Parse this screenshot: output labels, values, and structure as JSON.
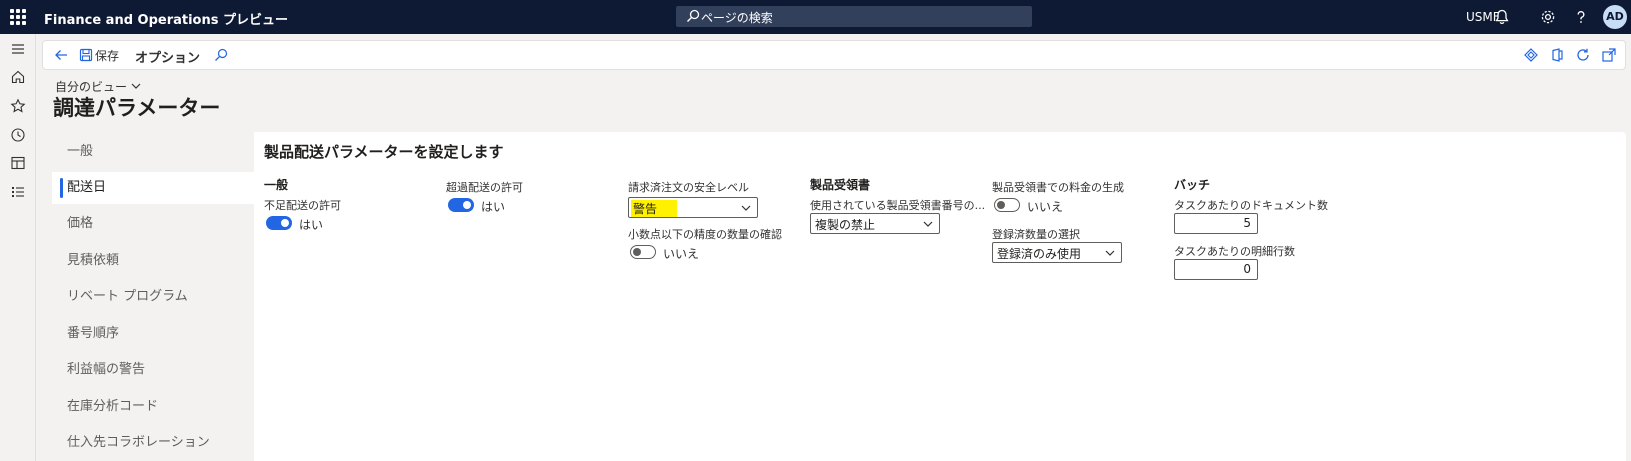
{
  "topbar": {
    "app_title": "Finance and Operations プレビュー",
    "search_placeholder": "ページの検索",
    "company": "USMF",
    "avatar_initials": "AD"
  },
  "action_pane": {
    "save_label": "保存",
    "options_label": "オプション"
  },
  "header": {
    "my_view": "自分のビュー",
    "page_title": "調達パラメーター"
  },
  "tabs": [
    {
      "label": "一般",
      "active": false
    },
    {
      "label": "配送日",
      "active": true
    },
    {
      "label": "価格",
      "active": false
    },
    {
      "label": "見積依頼",
      "active": false
    },
    {
      "label": "リベート プログラム",
      "active": false
    },
    {
      "label": "番号順序",
      "active": false
    },
    {
      "label": "利益幅の警告",
      "active": false
    },
    {
      "label": "在庫分析コード",
      "active": false
    },
    {
      "label": "仕入先コラボレーション",
      "active": false
    }
  ],
  "section": {
    "title": "製品配送パラメーターを設定します",
    "general": {
      "group_label": "一般",
      "underdelivery_label": "不足配送の許可",
      "underdelivery_value": "はい",
      "overdelivery_label": "超過配送の許可",
      "overdelivery_value": "はい",
      "invoice_security_label": "請求済注文の安全レベル",
      "invoice_security_value": "警告",
      "decimal_check_label": "小数点以下の精度の数量の確認",
      "decimal_check_value": "いいえ"
    },
    "receipt": {
      "group_label": "製品受領書",
      "number_used_label": "使用されている製品受領書番号の...",
      "number_used_value": "複製の禁止",
      "charges_label": "製品受領書での料金の生成",
      "charges_value": "いいえ",
      "registered_label": "登録済数量の選択",
      "registered_value": "登録済のみ使用"
    },
    "batch": {
      "group_label": "バッチ",
      "docs_per_task_label": "タスクあたりのドキュメント数",
      "docs_per_task_value": "5",
      "lines_per_task_label": "タスクあたりの明細行数",
      "lines_per_task_value": "0"
    }
  },
  "colors": {
    "topbar_bg": "#0e1933",
    "accent": "#2266e3",
    "highlight": "#fff100"
  }
}
